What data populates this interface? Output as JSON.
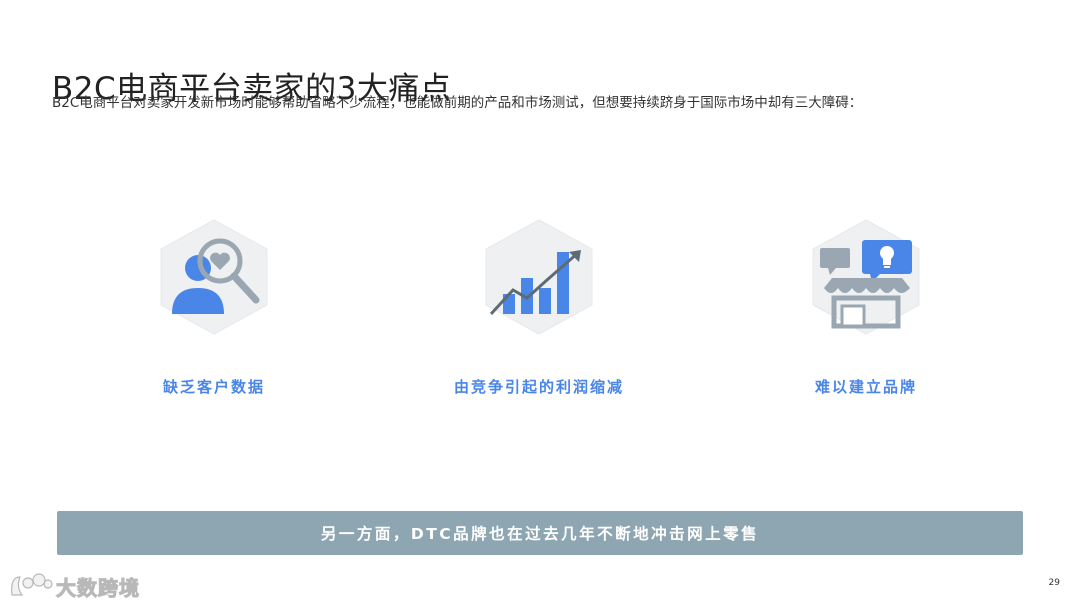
{
  "title": "B2C电商平台卖家的3大痛点",
  "subtitle": "B2C电商平台对卖家开发新市场时能够帮助省略不少流程，也能做前期的产品和市场测试，但想要持续跻身于国际市场中却有三大障碍：",
  "pain_points": [
    {
      "label": "缺乏客户数据",
      "icon": "user-search-icon"
    },
    {
      "label": "由竞争引起的利润缩减",
      "icon": "bar-chart-trend-icon"
    },
    {
      "label": "难以建立品牌",
      "icon": "storefront-idea-icon"
    }
  ],
  "banner": "另一方面，DTC品牌也在过去几年不断地冲击网上零售",
  "logo": {
    "text": "大数跨境",
    "icon": "brand-logo-icon"
  },
  "page_number": "29",
  "colors": {
    "accent": "#4a86e8",
    "banner": "#8ea6b2",
    "hex_bg": "#eef0f2",
    "icon_gray": "#9aa7b3"
  }
}
